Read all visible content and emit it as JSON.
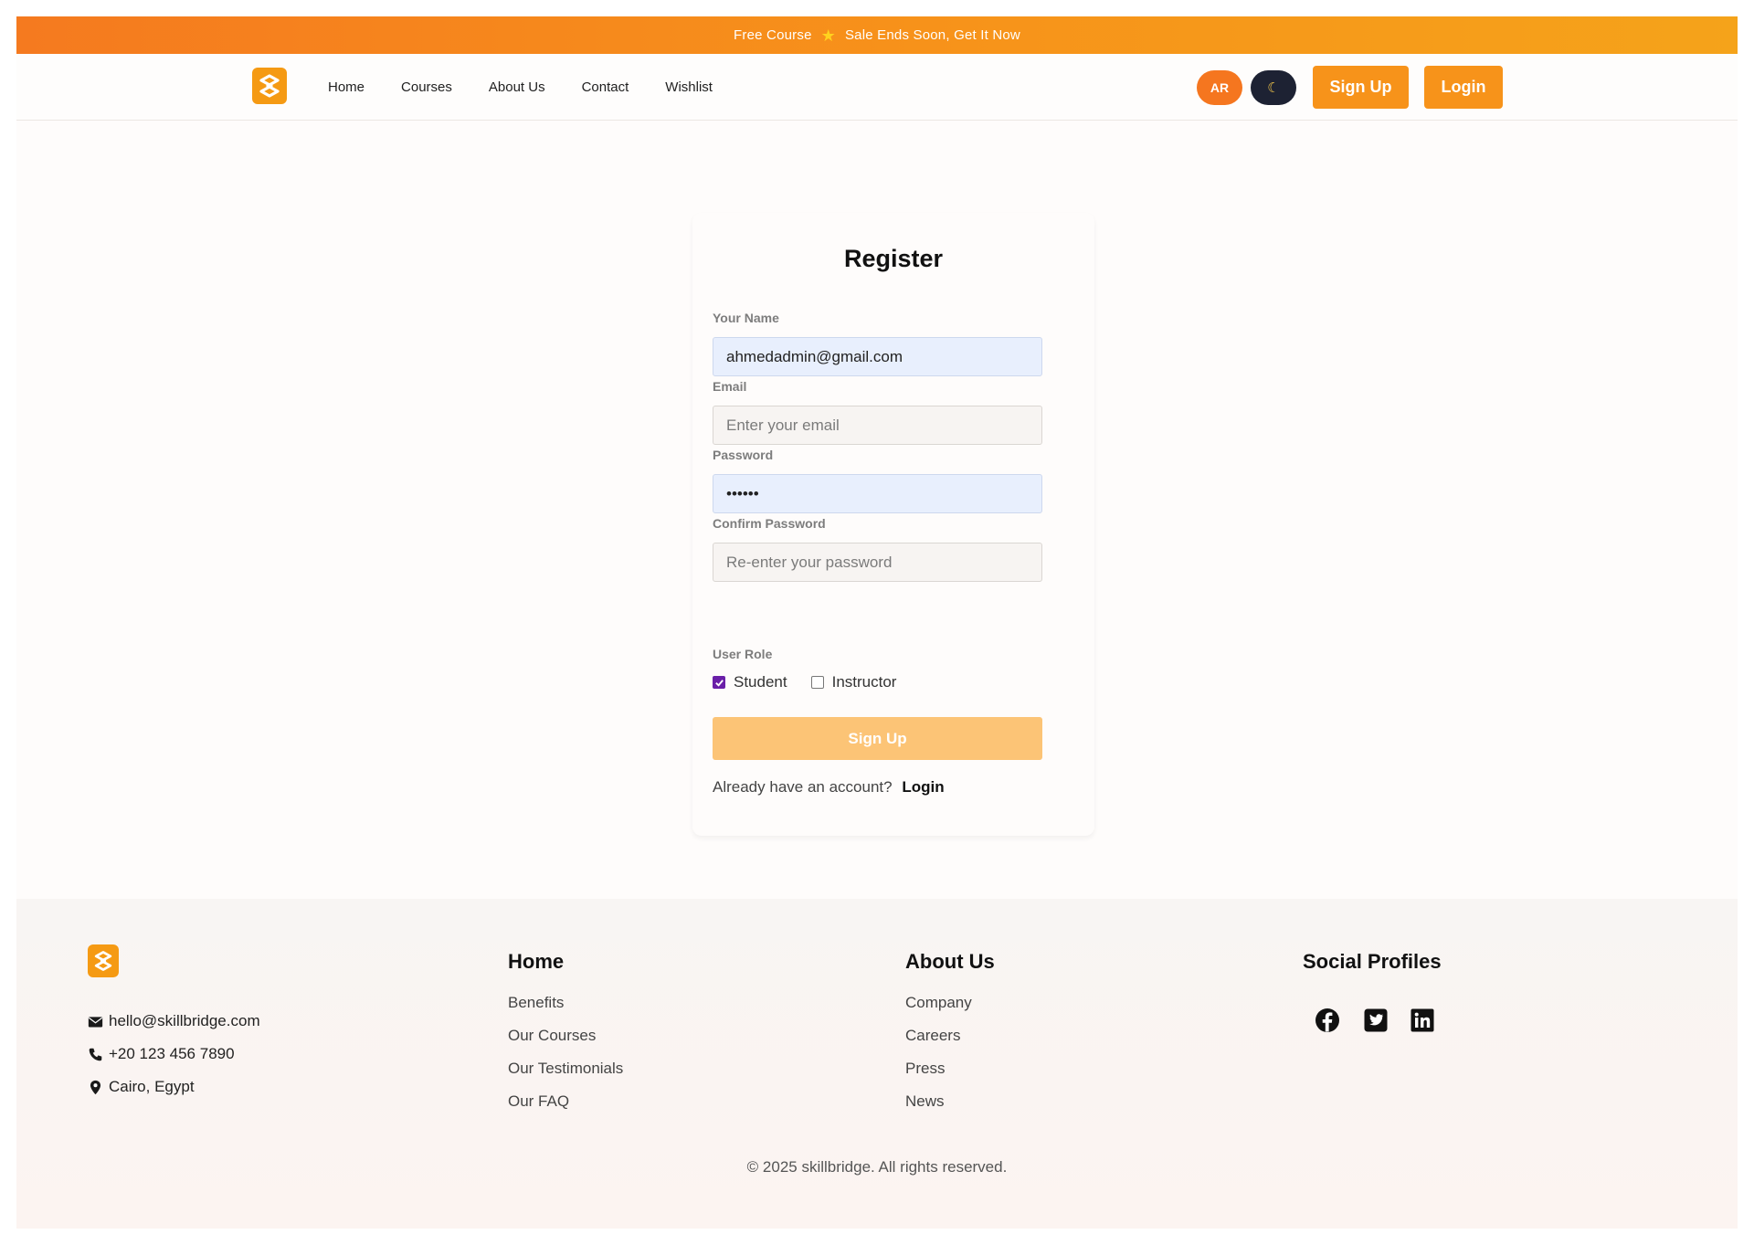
{
  "announcement": {
    "left_text": "Free Course",
    "star_icon": "star-icon",
    "right_text": "Sale Ends Soon, Get It Now"
  },
  "nav": {
    "links": [
      "Home",
      "Courses",
      "About Us",
      "Contact",
      "Wishlist"
    ],
    "lang_label": "AR",
    "theme_icon": "moon-icon",
    "signup_label": "Sign Up",
    "login_label": "Login"
  },
  "register": {
    "title": "Register",
    "name_label": "Your Name",
    "name_value": "ahmedadmin@gmail.com",
    "email_label": "Email",
    "email_placeholder": "Enter your email",
    "password_label": "Password",
    "password_value": "••••••",
    "confirm_label": "Confirm Password",
    "confirm_placeholder": "Re-enter your password",
    "role_label": "User Role",
    "roles": [
      {
        "label": "Student",
        "checked": true
      },
      {
        "label": "Instructor",
        "checked": false
      }
    ],
    "submit_label": "Sign Up",
    "already_text": "Already have an account?",
    "login_link": "Login"
  },
  "footer": {
    "email": "hello@skillbridge.com",
    "phone": "+20 123 456 7890",
    "location": "Cairo, Egypt",
    "col1_title": "Home",
    "col1_links": [
      "Benefits",
      "Our Courses",
      "Our Testimonials",
      "Our FAQ"
    ],
    "col2_title": "About Us",
    "col2_links": [
      "Company",
      "Careers",
      "Press",
      "News"
    ],
    "col3_title": "Social Profiles",
    "social_icons": [
      "facebook-icon",
      "twitter-icon",
      "linkedin-icon"
    ],
    "copyright": "© 2025 skillbridge. All rights reserved."
  },
  "colors": {
    "accent": "#f7931a",
    "lang_button": "#f5761f",
    "theme_button": "#1d2233",
    "submit_disabled": "#fcc476",
    "checkbox_checked": "#6a1fa8"
  }
}
